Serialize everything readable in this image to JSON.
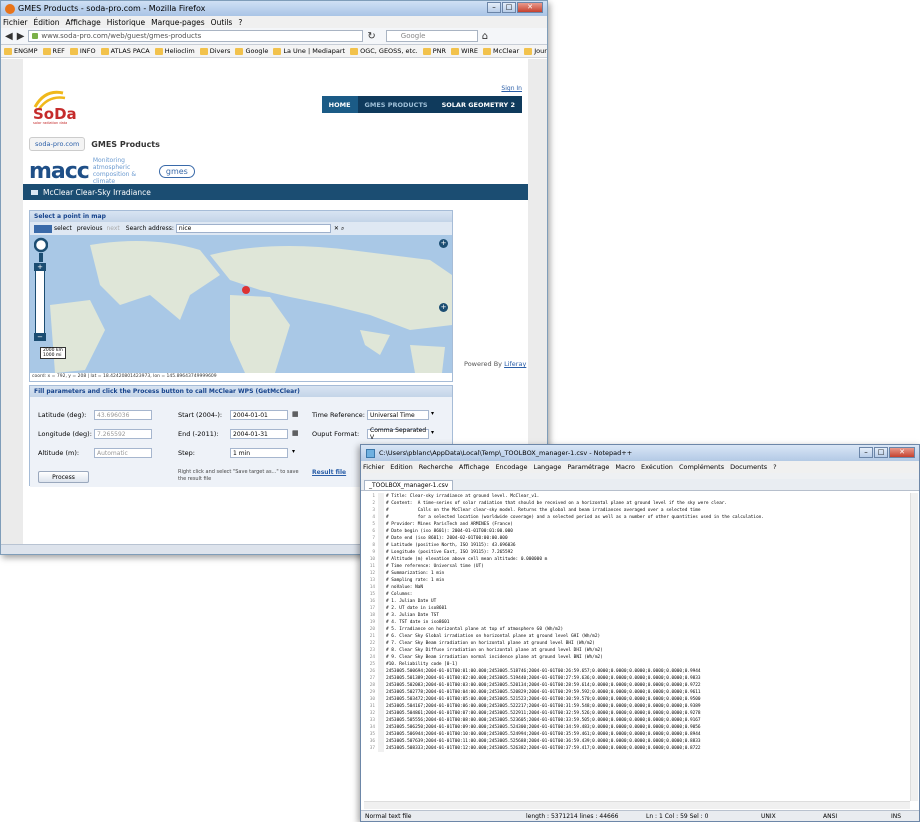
{
  "firefox": {
    "title": "GMES Products - soda-pro.com - Mozilla Firefox",
    "menu": [
      "Fichier",
      "Édition",
      "Affichage",
      "Historique",
      "Marque-pages",
      "Outils",
      "?"
    ],
    "url": "www.soda-pro.com/web/guest/gmes-products",
    "search_placeholder": "Google",
    "bookmarks": [
      "ENGMP",
      "REF",
      "INFO",
      "ATLAS PACA",
      "Helioclim",
      "Divers",
      "Google",
      "La Une | Mediapart",
      "OGC, GEOSS, etc.",
      "PNR",
      "WIRE",
      "McClear",
      "Journaux"
    ],
    "sign_in": "Sign In",
    "nav": [
      "HOME",
      "GMES PRODUCTS",
      "SOLAR GEOMETRY 2"
    ],
    "breadcrumb_site": "soda-pro.com",
    "breadcrumb_page": "GMES Products",
    "macc": "macc",
    "macc_tagline": "Monitoring atmospheric composition & climate",
    "gmes": "gmes",
    "section_title": "McClear Clear-Sky Irradiance",
    "map_panel_title": "Select a point in map",
    "map_select": "select",
    "map_previous": "previous",
    "map_next": "next",
    "search_label": "Search address:",
    "search_value": "nice",
    "scale_km": "2000 km",
    "scale_mi": "1000 mi",
    "coord_readout": "coord: x = 792, y = 208 | lat = 18.42420801423973, lon = 145.89643749999609",
    "params_title": "Fill parameters and click the Process button to call McClear WPS (GetMcClear)",
    "lat_label": "Latitude (deg):",
    "lat_value": "43.696036",
    "lon_label": "Longitude (deg):",
    "lon_value": "7.265592",
    "alt_label": "Altitude (m):",
    "alt_value": "Automatic",
    "start_label": "Start (2004-):",
    "start_value": "2004-01-01",
    "end_label": "End (-2011):",
    "end_value": "2004-01-31",
    "step_label": "Step:",
    "step_value": "1 min",
    "timeref_label": "Time Reference:",
    "timeref_value": "Universal Time",
    "format_label": "Ouput Format:",
    "format_value": "Comma Separated V",
    "process": "Process",
    "right_click_note": "Right click and select \"Save target as...\" to save the result file",
    "result_file": "Result file",
    "powered_by": "Powered By",
    "liferay": "Liferay"
  },
  "notepad": {
    "title": "C:\\Users\\pblanc\\AppData\\Local\\Temp\\_TOOLBOX_manager-1.csv - Notepad++",
    "menu": [
      "Fichier",
      "Edition",
      "Recherche",
      "Affichage",
      "Encodage",
      "Langage",
      "Paramétrage",
      "Macro",
      "Exécution",
      "Compléments",
      "Documents",
      "?"
    ],
    "tab": "_TOOLBOX_manager-1.csv",
    "lines": [
      "# Title: Clear-sky irradiance at ground level. McClear_v1.",
      "# Content:  A time-series of solar radiation that should be received on a horizontal plane at ground level if the sky were clear.",
      "#           Calls on the McClear clear-sky model. Returns the global and beam irradiances averaged over a selected time",
      "#           for a selected location (worldwide coverage) and a selected period as well as a number of other quantities used in the calculation.",
      "# Provider: Mines ParisTech and ARMINES (France)",
      "# Date begin (iso 8601): 2004-01-01T00:01:00.000",
      "# Date end (iso 8601): 2004-02-01T00:00:00.000",
      "# Latitude (positive North, ISO 19115): 43.696036",
      "# Longitude (positive East, ISO 19115): 7.265592",
      "# Altitude (m) elevation above cell mean altitude: 0.000000 m",
      "# Time reference: Universal time (UT)",
      "# Summarization: 1 min",
      "# Sampling rate: 1 min",
      "# noValue: NaN",
      "# Columns:",
      "# 1. Julian Date UT",
      "# 2. UT date in iso8601",
      "# 3. Julian Date TST",
      "# 4. TST date in iso8601",
      "# 5. Irradiance on horizontal plane at top of atmosphere G0 (Wh/m2)",
      "# 6. Clear Sky Global irradiation on horizontal plane at ground level GHI (Wh/m2)",
      "# 7. Clear Sky Beam irradiation on horizontal plane at ground level BHI (Wh/m2)",
      "# 8. Clear Sky Diffuse irradiation on horizontal plane at ground level DHI (Wh/m2)",
      "# 9. Clear Sky Beam irradiation normal incidence plane at ground level BNI (Wh/m2)",
      "#10. Reliability code [0-1]",
      "2453005.500694;2004-01-01T00:01:00.000;2453005.518746;2004-01-01T00:26:59.657;0.0000;0.0000;0.0000;0.0000;0.0000;0.9944",
      "2453005.501389;2004-01-01T00:02:00.000;2453005.519440;2004-01-01T00:27:59.636;0.0000;0.0000;0.0000;0.0000;0.0000;0.9833",
      "2453005.502083;2004-01-01T00:03:00.000;2453005.520134;2004-01-01T00:28:59.614;0.0000;0.0000;0.0000;0.0000;0.0000;0.9722",
      "2453005.502778;2004-01-01T00:04:00.000;2453005.520829;2004-01-01T00:29:59.592;0.0000;0.0000;0.0000;0.0000;0.0000;0.9611",
      "2453005.503472;2004-01-01T00:05:00.000;2453005.521523;2004-01-01T00:30:59.570;0.0000;0.0000;0.0000;0.0000;0.0000;0.9500",
      "2453005.504167;2004-01-01T00:06:00.000;2453005.522217;2004-01-01T00:31:59.548;0.0000;0.0000;0.0000;0.0000;0.0000;0.9389",
      "2453005.504861;2004-01-01T00:07:00.000;2453005.522911;2004-01-01T00:32:59.526;0.0000;0.0000;0.0000;0.0000;0.0000;0.9278",
      "2453005.505556;2004-01-01T00:08:00.000;2453005.523605;2004-01-01T00:33:59.505;0.0000;0.0000;0.0000;0.0000;0.0000;0.9167",
      "2453005.506250;2004-01-01T00:09:00.000;2453005.524300;2004-01-01T00:34:59.483;0.0000;0.0000;0.0000;0.0000;0.0000;0.9056",
      "2453005.506944;2004-01-01T00:10:00.000;2453005.524994;2004-01-01T00:35:59.461;0.0000;0.0000;0.0000;0.0000;0.0000;0.8944",
      "2453005.507639;2004-01-01T00:11:00.000;2453005.525688;2004-01-01T00:36:59.439;0.0000;0.0000;0.0000;0.0000;0.0000;0.8833",
      "2453005.508333;2004-01-01T00:12:00.000;2453005.526382;2004-01-01T00:37:59.417;0.0000;0.0000;0.0000;0.0000;0.0000;0.8722"
    ],
    "status_type": "Normal text file",
    "status_length": "length : 5371214    lines : 44666",
    "status_pos": "Ln : 1    Col : 59    Sel : 0",
    "status_eol": "UNIX",
    "status_enc": "ANSI",
    "status_ins": "INS"
  }
}
